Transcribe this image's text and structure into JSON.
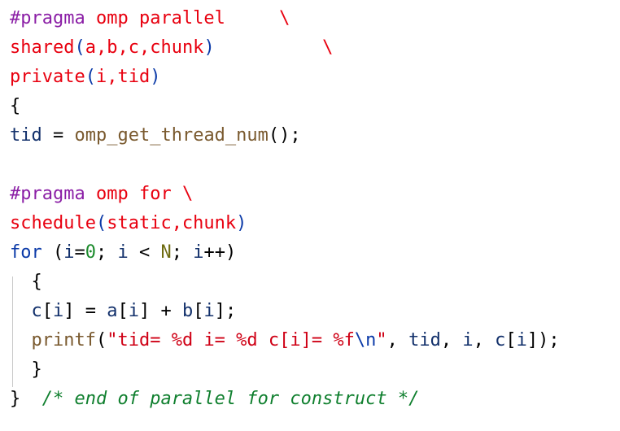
{
  "code": {
    "l1": [
      "#pragma",
      " ",
      "omp parallel",
      "     ",
      "\\"
    ],
    "l2": [
      "shared",
      "(",
      "a,b,c,chunk",
      ")",
      "          ",
      "\\"
    ],
    "l3": [
      "private",
      "(",
      "i,tid",
      ")"
    ],
    "l4": [
      "{"
    ],
    "l5": [
      "tid",
      " = ",
      "omp_get_thread_num",
      "();"
    ],
    "l7": [
      "#pragma",
      " ",
      "omp for",
      " ",
      "\\"
    ],
    "l8": [
      "schedule",
      "(",
      "static,chunk",
      ")"
    ],
    "l9": [
      "for",
      " (",
      "i",
      "=",
      "0",
      "; ",
      "i",
      " < ",
      "N",
      "; ",
      "i",
      "++)"
    ],
    "l10": [
      "  {"
    ],
    "l11": [
      "  ",
      "c",
      "[",
      "i",
      "]",
      " = ",
      "a",
      "[",
      "i",
      "]",
      " + ",
      "b",
      "[",
      "i",
      "];"
    ],
    "l12": [
      "  ",
      "printf",
      "(",
      "\"tid= %d i= %d c[i]= %f",
      "\\n",
      "\"",
      ", ",
      "tid",
      ", ",
      "i",
      ", ",
      "c",
      "[",
      "i",
      "]);"
    ],
    "l13": [
      "  }"
    ],
    "l14": [
      "}",
      "  ",
      "/* end of parallel for construct */"
    ]
  }
}
